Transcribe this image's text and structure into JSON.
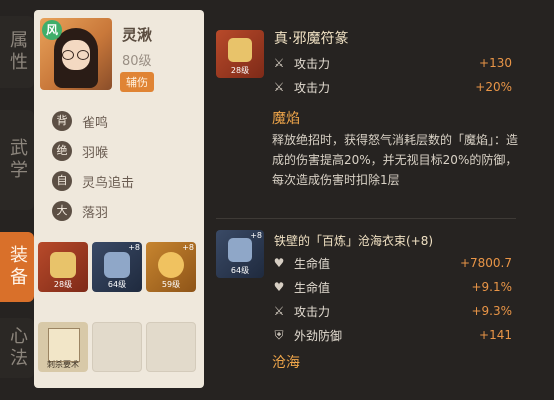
{
  "tabs": [
    {
      "label": "属性"
    },
    {
      "label": "武学"
    },
    {
      "label": "装备",
      "active": true
    },
    {
      "label": "心法"
    }
  ],
  "character": {
    "element_badge": "风",
    "name": "灵湫",
    "level": "80级",
    "role": "辅伤",
    "skills": [
      {
        "chip": "背",
        "label": "雀鸣"
      },
      {
        "chip": "绝",
        "label": "羽喉"
      },
      {
        "chip": "自",
        "label": "灵鸟追击"
      },
      {
        "chip": "大",
        "label": "落羽"
      }
    ]
  },
  "equipment_slots": [
    {
      "level": "28级",
      "color": "red"
    },
    {
      "level": "64级",
      "plus": "+8",
      "color": "blue"
    },
    {
      "level": "59级",
      "plus": "+8",
      "color": "orange"
    }
  ],
  "mind_slot": {
    "caption": "刺杀要术"
  },
  "item1": {
    "title": "真·邪魔符篆",
    "level": "28级",
    "stats": [
      {
        "icon": "sword-icon",
        "name": "攻击力",
        "value": "+130"
      },
      {
        "icon": "sword-icon",
        "name": "攻击力",
        "value": "+20%"
      }
    ],
    "effect_title": "魔焰",
    "effect_desc": "释放绝招时，获得怒气消耗层数的「魔焰」：造成的伤害提高20%，并无视目标20%的防御，每次造成伤害时扣除1层"
  },
  "item2": {
    "title": "铁壁的「百炼」沧海衣束(+8)",
    "level": "64级",
    "plus": "+8",
    "stats": [
      {
        "icon": "heart-icon",
        "name": "生命值",
        "value": "+7800.7"
      },
      {
        "icon": "heart-icon",
        "name": "生命值",
        "value": "+9.1%"
      },
      {
        "icon": "sword-icon",
        "name": "攻击力",
        "value": "+9.3%"
      },
      {
        "icon": "shield-icon",
        "name": "外劲防御",
        "value": "+141"
      }
    ],
    "effect_title": "沧海"
  },
  "colors": {
    "accent": "#d9702a",
    "value": "#e99547",
    "effect_title": "#f0a64a"
  }
}
